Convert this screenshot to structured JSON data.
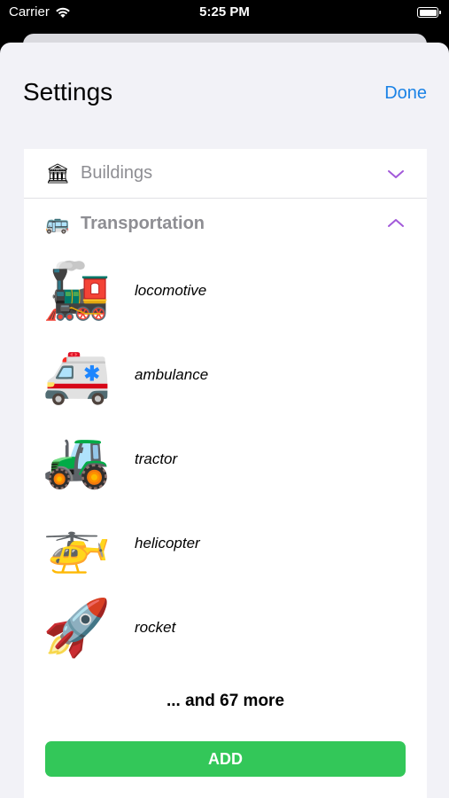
{
  "status_bar": {
    "carrier": "Carrier",
    "time": "5:25 PM",
    "battery_level": 1.0
  },
  "sheet": {
    "title": "Settings",
    "done_label": "Done",
    "accent_color": "#1a82e6"
  },
  "sections": [
    {
      "label": "Buildings",
      "emoji": "🏛",
      "expanded": false,
      "chevron_color": "#a259d9"
    },
    {
      "label": "Transportation",
      "emoji": "🚌",
      "expanded": true,
      "chevron_color": "#a259d9"
    }
  ],
  "items": [
    {
      "emoji": "🚂",
      "label": "locomotive"
    },
    {
      "emoji": "🚑",
      "label": "ambulance"
    },
    {
      "emoji": "🚜",
      "label": "tractor"
    },
    {
      "emoji": "🚁",
      "label": "helicopter"
    },
    {
      "emoji": "🚀",
      "label": "rocket"
    }
  ],
  "more_text": "... and 67 more",
  "add_button": {
    "label": "ADD",
    "color": "#33c759"
  }
}
